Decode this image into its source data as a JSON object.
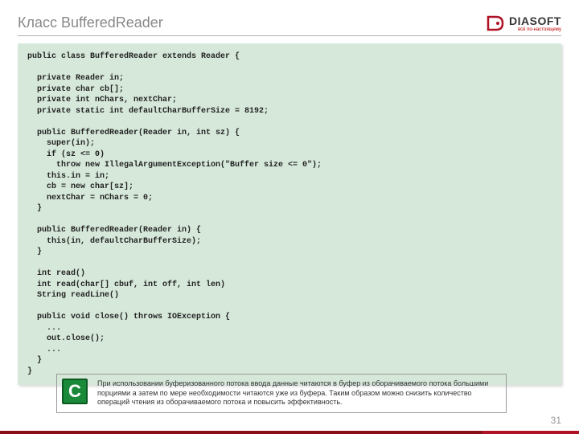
{
  "header": {
    "title": "Класс BufferedReader",
    "logo_text": "DIASOFT",
    "logo_sub": "всё по-настоящему"
  },
  "code": "public class BufferedReader extends Reader {\n\n  private Reader in;\n  private char cb[];\n  private int nChars, nextChar;\n  private static int defaultCharBufferSize = 8192;\n\n  public BufferedReader(Reader in, int sz) {\n    super(in);\n    if (sz <= 0)\n      throw new IllegalArgumentException(\"Buffer size <= 0\");\n    this.in = in;\n    cb = new char[sz];\n    nextChar = nChars = 0;\n  }\n\n  public BufferedReader(Reader in) {\n    this(in, defaultCharBufferSize);\n  }\n\n  int read()\n  int read(char[] cbuf, int off, int len)\n  String readLine()\n\n  public void close() throws IOException {\n    ...\n    out.close();\n    ...\n  }\n}",
  "note": {
    "badge": "C",
    "text": "При использовании буферизованного потока ввода данные читаются в буфер из оборачиваемого потока большими порциями а затем по мере необходимости читаются уже из буфера. Таким образом можно снизить количество операций чтения из оборачиваемого потока и повысить эффективность."
  },
  "page_number": "31"
}
